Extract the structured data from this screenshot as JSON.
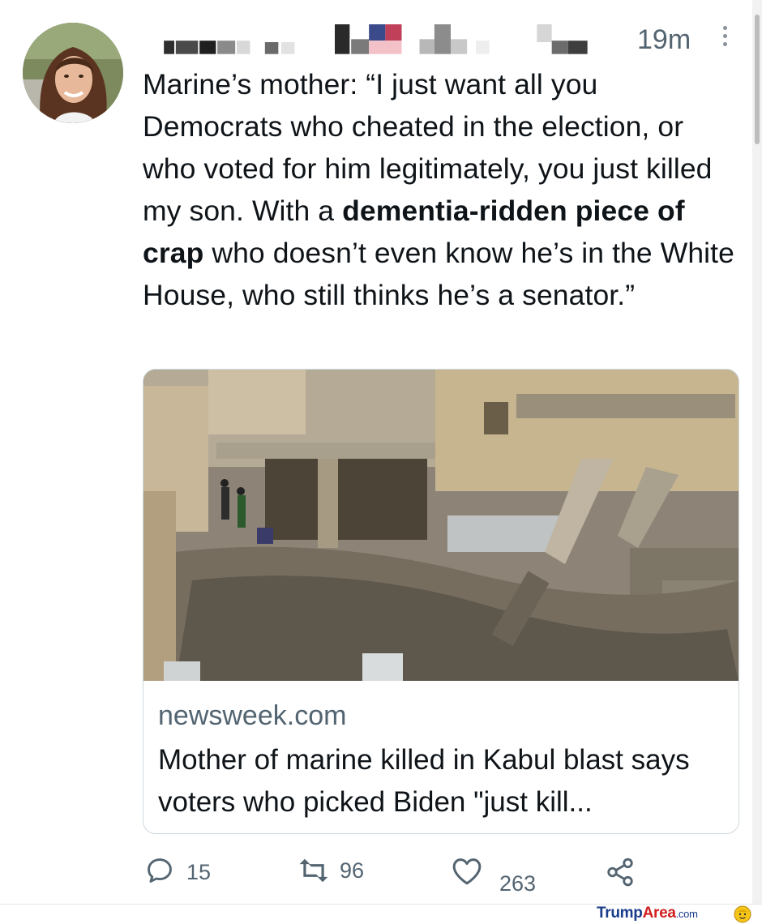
{
  "tweet": {
    "timestamp": "19m",
    "text_parts": [
      {
        "text": "Marine’s mother: “I just want all you Democrats who cheated in the election, or who voted for him legitimately, you just killed my son. With a ",
        "bold": false
      },
      {
        "text": "dementia-ridden piece of crap",
        "bold": true
      },
      {
        "text": " who doesn’t even know he’s in the White House, who still thinks he’s a senator.”",
        "bold": false
      }
    ],
    "icons": {
      "avatar": "profile-photo",
      "more": "more-vertical-icon"
    }
  },
  "card": {
    "image_description_icon": "rubble-photo",
    "domain": "newsweek.com",
    "title": "Mother of marine killed in Kabul blast says voters who picked Biden \"just kill..."
  },
  "actions": {
    "reply": {
      "icon": "reply-icon",
      "count": "15"
    },
    "retweet": {
      "icon": "retweet-icon",
      "count": "96"
    },
    "like": {
      "icon": "heart-icon",
      "count": "263"
    },
    "share": {
      "icon": "share-icon"
    }
  },
  "watermark": {
    "part1": "Trump",
    "part2": "Area",
    "part3": ".com"
  },
  "colors": {
    "text": "#0f1419",
    "secondary": "#536471",
    "border": "#cfd9de"
  }
}
